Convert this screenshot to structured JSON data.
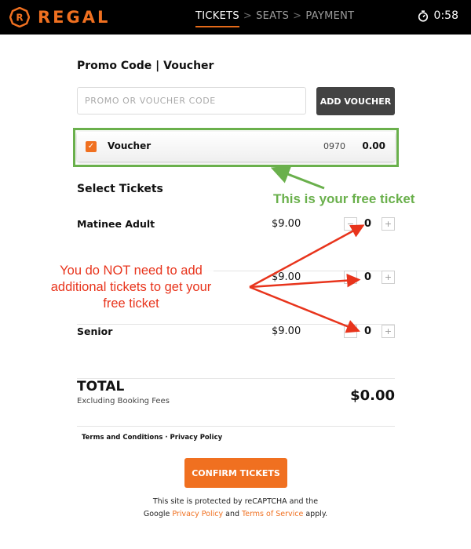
{
  "header": {
    "brand": "REGAL",
    "steps": [
      {
        "label": "TICKETS",
        "active": true
      },
      {
        "label": "SEATS",
        "active": false
      },
      {
        "label": "PAYMENT",
        "active": false
      }
    ],
    "separator": ">",
    "timer": "0:58"
  },
  "promo": {
    "title": "Promo Code | Voucher",
    "placeholder": "PROMO OR VOUCHER CODE",
    "value": "",
    "add_button": "ADD VOUCHER"
  },
  "voucher": {
    "checked": true,
    "check_glyph": "✓",
    "label": "Voucher",
    "code": "0970",
    "amount": "0.00"
  },
  "tickets": {
    "title": "Select Tickets",
    "rows": [
      {
        "name": "Matinee Adult",
        "price": "$9.00",
        "qty": "0"
      },
      {
        "name": "",
        "price": "$9.00",
        "qty": "0"
      },
      {
        "name": "Senior",
        "price": "$9.00",
        "qty": "0"
      }
    ],
    "minus": "−",
    "plus": "+"
  },
  "total": {
    "label": "TOTAL",
    "sub": "Excluding Booking Fees",
    "value": "$0.00"
  },
  "footer": {
    "terms": "Terms and Conditions",
    "dot": " · ",
    "privacy": "Privacy Policy",
    "confirm": "CONFIRM TICKETS",
    "recaptcha_line1": "This site is protected by reCAPTCHA and the",
    "recaptcha_google": "Google ",
    "recaptcha_privacy": "Privacy Policy",
    "recaptcha_and": " and ",
    "recaptcha_terms": "Terms of Service",
    "recaptcha_apply": " apply."
  },
  "annotations": {
    "green_text": "This is your free ticket",
    "red_text": "You do NOT need to add additional tickets to get your free ticket",
    "green_color": "#6ab04c",
    "red_color": "#e8341c"
  },
  "colors": {
    "brand_orange": "#f07020",
    "header_bg": "#000000",
    "button_dark": "#434343"
  }
}
